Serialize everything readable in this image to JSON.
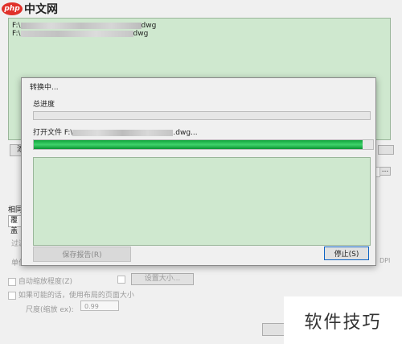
{
  "logo": {
    "mark": "php",
    "text": "中文网"
  },
  "file_list": {
    "rows": [
      "F:\\",
      "F:\\"
    ],
    "suffixes": [
      "dwg",
      "dwg"
    ]
  },
  "main": {
    "add_label": "添加",
    "more_label": "...",
    "group_label": "相同文",
    "combo_value": "覆盖",
    "faded_row1": "过滤",
    "faded_row2": "单位",
    "auto_scale_label": "自动缩放程度(Z)",
    "page_size_label": "设置大小...",
    "layout_size_label": "如果可能的话，使用布局的页面大小",
    "scale_label": "尺度(缩放 ex):",
    "scale_value": "0.99",
    "dpi_label": "DPI"
  },
  "dialog": {
    "title": "转换中...",
    "total_label": "总进度",
    "total_progress": 0,
    "file_prefix": "打开文件 F:\\",
    "file_suffix": ".dwg...",
    "file_progress": 0.97,
    "save_report_label": "保存报告(R)",
    "stop_label": "停止(S)"
  },
  "watermark": {
    "text": "软件技巧"
  }
}
